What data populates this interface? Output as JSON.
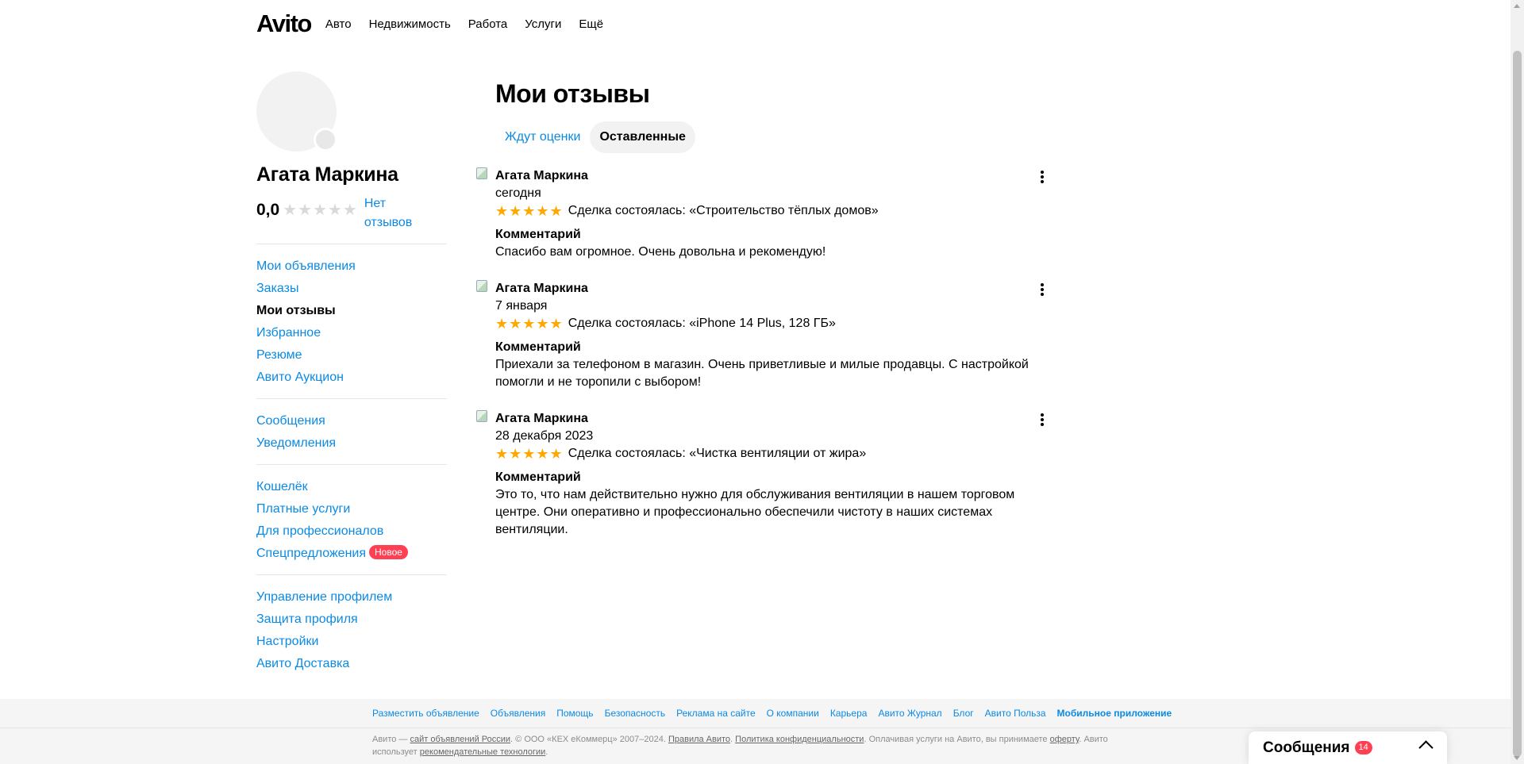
{
  "header": {
    "logo": "Avito",
    "nav": [
      "Авто",
      "Недвижимость",
      "Работа",
      "Услуги",
      "Ещё"
    ]
  },
  "profile": {
    "name": "Агата Маркина",
    "rating": "0,0",
    "stars_filled": 0,
    "stars_total": 5,
    "no_reviews": "Нет отзывов"
  },
  "sidebar_menu": {
    "group1": [
      "Мои объявления",
      "Заказы",
      "Мои отзывы",
      "Избранное",
      "Резюме",
      "Авито Аукцион"
    ],
    "group2": [
      "Сообщения",
      "Уведомления"
    ],
    "group3": [
      "Кошелёк",
      "Платные услуги",
      "Для профессионалов",
      "Спецпредложения"
    ],
    "group3_badge": "Новое",
    "group4": [
      "Управление профилем",
      "Защита профиля",
      "Настройки",
      "Авито Доставка"
    ]
  },
  "main": {
    "title": "Мои отзывы",
    "tabs": [
      "Ждут оценки",
      "Оставленные"
    ],
    "comment_label": "Комментарий",
    "reviews": [
      {
        "author": "Агата Маркина",
        "date": "сегодня",
        "stars": 5,
        "deal": "Сделка состоялась: «Строительство тёплых домов»",
        "comment": "Спасибо вам огромное. Очень довольна и рекомендую!"
      },
      {
        "author": "Агата Маркина",
        "date": "7 января",
        "stars": 5,
        "deal": "Сделка состоялась: «iPhone 14 Plus, 128 ГБ»",
        "comment": "Приехали за телефоном в магазин. Очень приветливые и милые продавцы. С настройкой помогли и не торопили с выбором!"
      },
      {
        "author": "Агата Маркина",
        "date": "28 декабря 2023",
        "stars": 5,
        "deal": "Сделка состоялась: «Чистка вентиляции от жира»",
        "comment": "Это то, что нам действительно нужно для обслуживания вентиляции в нашем торговом центре. Они оперативно и профессионально обеспечили чистоту в наших системах вентиляции."
      }
    ]
  },
  "footer": {
    "links": [
      "Разместить объявление",
      "Объявления",
      "Помощь",
      "Безопасность",
      "Реклама на сайте",
      "О компании",
      "Карьера",
      "Авито Журнал",
      "Блог",
      "Авито Польза",
      "Мобильное приложение"
    ],
    "text_1": "Авито — ",
    "link_1": "сайт объявлений России",
    "text_2": ". © ООО «КЕХ еКоммерц» 2007–2024. ",
    "link_2": "Правила Авито",
    "text_3": ". ",
    "link_3": "Политика конфиденциальности",
    "text_4": ". Оплачивая услуги на Авито, вы принимаете ",
    "link_4": "оферту",
    "text_5": ". Авито использует ",
    "link_5": "рекомендательные технологии",
    "text_6": "."
  },
  "messenger": {
    "title": "Сообщения",
    "count": "14"
  },
  "colors": {
    "link": "#0a8ae5",
    "star_active": "#ffa800",
    "star_inactive": "#d9d9d9",
    "badge": "#ff4053"
  }
}
